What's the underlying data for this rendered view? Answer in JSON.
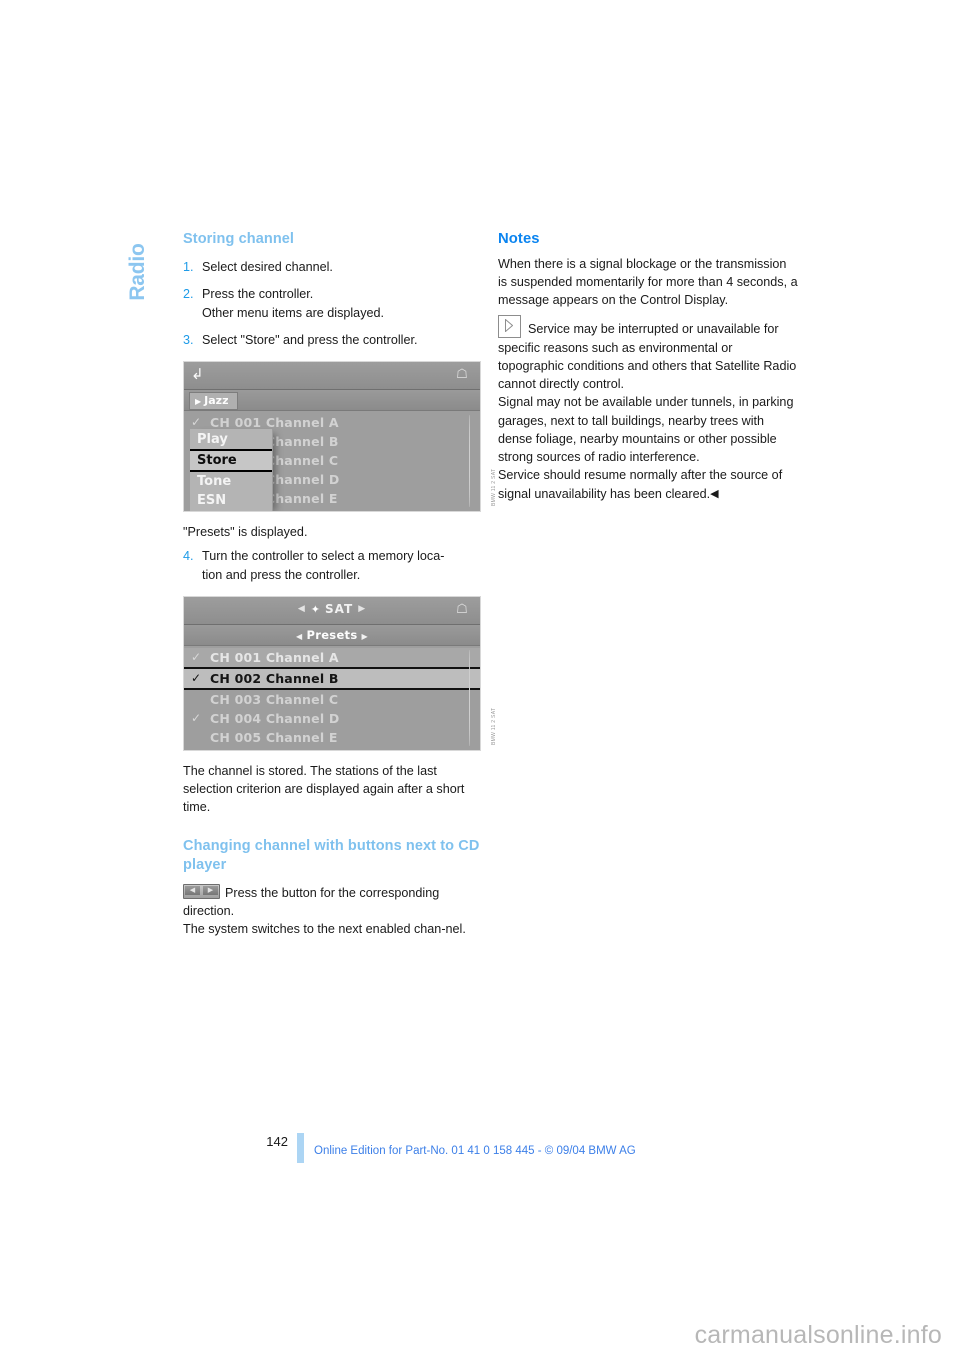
{
  "chapter": {
    "title": "Radio"
  },
  "colors": {
    "heading_light_blue": "#7FC1EE",
    "heading_blue": "#0A84F0",
    "step_number_blue": "#1E9BE8",
    "footer_blue": "#3C7FE8",
    "footer_rule": "#ACD5F4",
    "watermark_gray": "#b7b7b7"
  },
  "left_column": {
    "heading": "Storing channel",
    "steps": [
      {
        "num": "1.",
        "text": "Select desired channel."
      },
      {
        "num": "2.",
        "text": "Press the controller.",
        "sub": "Other menu items are displayed."
      },
      {
        "num": "3.",
        "text": "Select \"Store\" and press the controller."
      }
    ],
    "figure1": {
      "name": "store-menu-screenshot",
      "topbar": {
        "back_icon": "back-arrow-icon",
        "home_icon": "home-icon"
      },
      "subbar": {
        "tag": "Jazz",
        "arrow": "›"
      },
      "list": [
        {
          "tick": true,
          "label": "CH 001 Channel A"
        },
        {
          "tick": false,
          "label": "CH 002 Channel B"
        },
        {
          "tick": false,
          "label": "CH 003 Channel C"
        },
        {
          "tick": false,
          "label": "CH 004 Channel D"
        },
        {
          "tick": false,
          "label": "CH 005 Channel E"
        }
      ],
      "popup_items": [
        {
          "label": "Play",
          "selected": false
        },
        {
          "label": "Store",
          "selected": true
        },
        {
          "label": "Tone",
          "selected": false
        },
        {
          "label": "ESN",
          "selected": false
        }
      ]
    },
    "caption1": "\"Presets\" is displayed.",
    "step4": {
      "num": "4.",
      "text": "Turn the controller to select a memory loca-",
      "text2": "tion and press the controller."
    },
    "figure2": {
      "name": "presets-screenshot",
      "topbar_title": "SAT",
      "topbar_left_arrow": "‹",
      "topbar_right_arrow": "›",
      "sat_icon": "satellite-icon",
      "home_icon": "home-icon",
      "subbar_title": "Presets",
      "list": [
        {
          "tick": true,
          "label": "CH 001 Channel A",
          "selected": false,
          "lighter": true
        },
        {
          "tick": true,
          "label": "CH 002 Channel B",
          "selected": true,
          "lighter": false
        },
        {
          "tick": false,
          "label": "CH 003 Channel C",
          "selected": false,
          "lighter": false
        },
        {
          "tick": true,
          "label": "CH 004 Channel D",
          "selected": false,
          "lighter": false
        },
        {
          "tick": false,
          "label": "CH 005 Channel E",
          "selected": false,
          "lighter": false
        }
      ]
    },
    "caption2": "The channel is stored. The stations of the last selection criterion are displayed again after a short time.",
    "heading2": "Changing channel with buttons next to CD player",
    "cd_icon_name": "cd-player-seek-buttons-icon",
    "para_cd_1": "Press the button for the corresponding direction.",
    "para_cd_2": "The system switches to the next enabled chan-nel."
  },
  "right_column": {
    "heading": "Notes",
    "para1": "When there is a signal blockage or the transmission is suspended momentarily for more than 4 seconds, a message appears on the Control Display.",
    "note_icon_name": "play-triangle-note-icon",
    "para2": "Service may be interrupted or unavailable for specific reasons such as environmental or topographic conditions and others that Satellite Radio cannot directly control.",
    "para3": "Signal may not be available under tunnels, in parking garages, next to tall buildings, nearby trees with dense foliage, nearby mountains or other possible strong sources of radio interference.",
    "para4": "Service should resume normally after the source of signal unavailability has been cleared.",
    "end_mark": "◀"
  },
  "footer": {
    "page_number": "142",
    "text": "Online Edition for Part-No. 01 41 0 158 445 - © 09/04 BMW AG"
  },
  "watermark": {
    "text": "carmanualsonline.info"
  }
}
